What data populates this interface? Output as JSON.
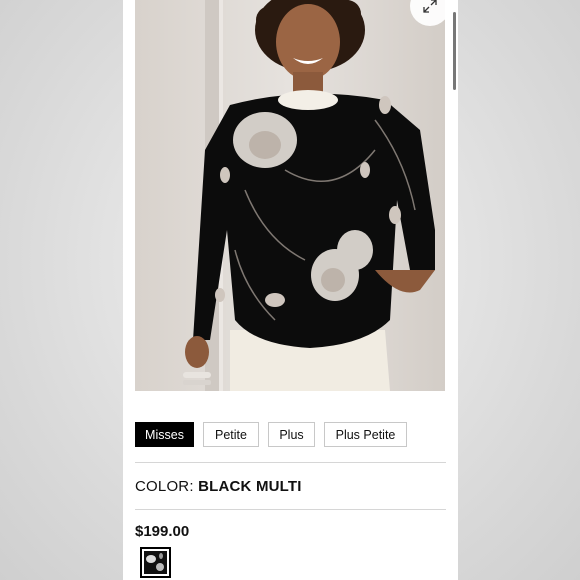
{
  "product": {
    "image_alt": "Model wearing black floral sweater",
    "expand_icon": "expand-arrows-icon"
  },
  "size_tabs": [
    {
      "label": "Misses",
      "active": true
    },
    {
      "label": "Petite",
      "active": false
    },
    {
      "label": "Plus",
      "active": false
    },
    {
      "label": "Plus Petite",
      "active": false
    }
  ],
  "color": {
    "label": "COLOR:",
    "value": "BLACK MULTI"
  },
  "price": "$199.00",
  "swatch": {
    "name": "Black Multi",
    "selected": true
  },
  "colors": {
    "active_tab_bg": "#000000",
    "border": "#c8c8c8",
    "text": "#111111"
  }
}
